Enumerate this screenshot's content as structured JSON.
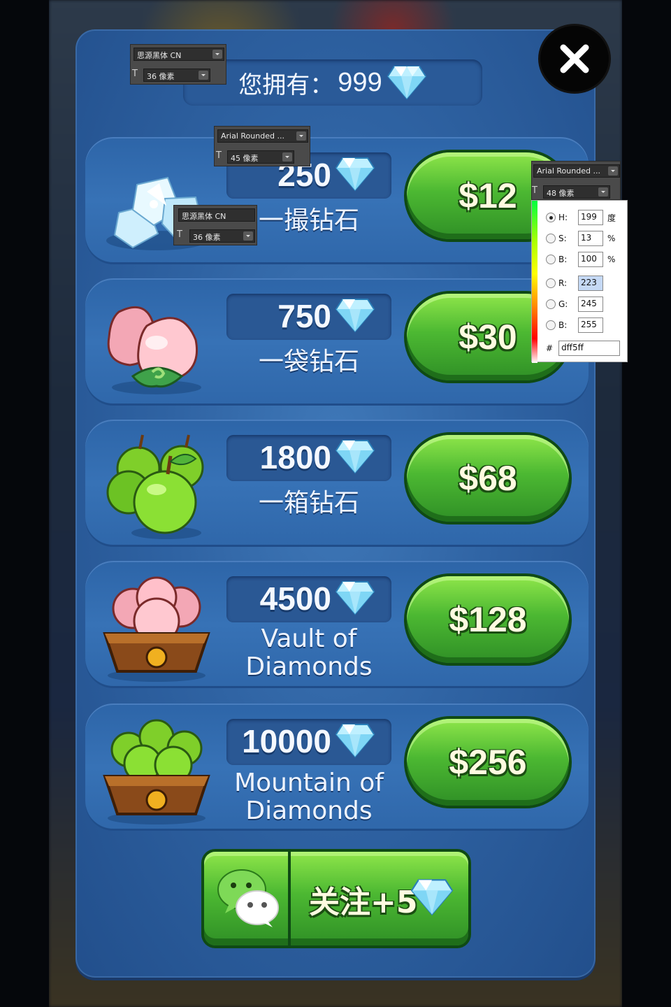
{
  "balance": {
    "label": "您拥有：",
    "value": "999"
  },
  "packs": [
    {
      "amount": "250",
      "name": "一撮钻石",
      "price": "$12"
    },
    {
      "amount": "750",
      "name": "一袋钻石",
      "price": "$30"
    },
    {
      "amount": "1800",
      "name": "一箱钻石",
      "price": "$68"
    },
    {
      "amount": "4500",
      "name_line1": "Vault of",
      "name_line2": "Diamonds",
      "price": "$128"
    },
    {
      "amount": "10000",
      "name_line1": "Mountain of",
      "name_line2": "Diamonds",
      "price": "$256"
    }
  ],
  "follow": {
    "label": "关注+5"
  },
  "annotations": {
    "font1": {
      "family": "思源黑体 CN",
      "size": "36 像素"
    },
    "font2": {
      "family": "Arial Rounded ...",
      "size": "45 像素"
    },
    "font3": {
      "family": "思源黑体 CN",
      "size": "36 像素"
    },
    "font4": {
      "family": "Arial Rounded ...",
      "size": "48 像素"
    }
  },
  "color_picker": {
    "h_label": "H:",
    "h": "199",
    "h_unit": "度",
    "s_label": "S:",
    "s": "13",
    "s_unit": "%",
    "b_label": "B:",
    "b": "100",
    "b_unit": "%",
    "r_label": "R:",
    "r": "223",
    "g_label": "G:",
    "g": "245",
    "b2_label": "B:",
    "b2": "255",
    "hash": "#",
    "hex": "dff5ff"
  },
  "colors": {
    "panel": "#2f63a3",
    "button_green": "#4cb832",
    "text_color": "#dff5ff"
  }
}
